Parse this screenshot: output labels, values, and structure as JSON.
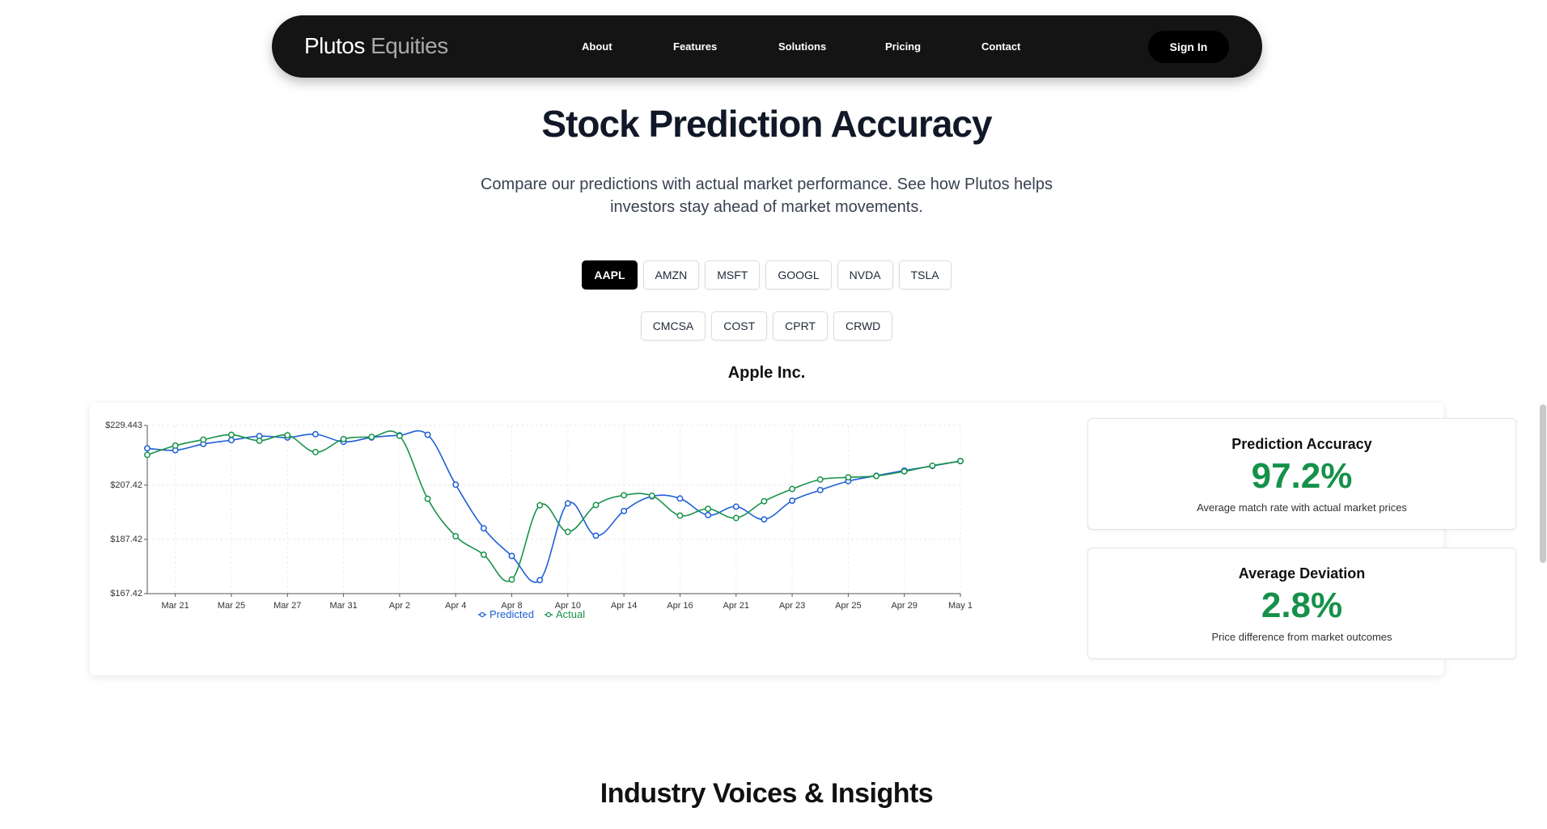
{
  "nav": {
    "brand_primary": "Plutos",
    "brand_secondary": "Equities",
    "links": [
      "About",
      "Features",
      "Solutions",
      "Pricing",
      "Contact"
    ],
    "signin_label": "Sign In"
  },
  "hero": {
    "title": "Stock Prediction Accuracy",
    "subtitle": "Compare our predictions with actual market performance. See how Plutos helps investors stay ahead of market movements."
  },
  "tickers": {
    "row1": [
      "AAPL",
      "AMZN",
      "MSFT",
      "GOOGL",
      "NVDA",
      "TSLA"
    ],
    "row2": [
      "CMCSA",
      "COST",
      "CPRT",
      "CRWD"
    ],
    "active": "AAPL"
  },
  "company_name": "Apple Inc.",
  "cards": [
    {
      "title": "Prediction Accuracy",
      "value": "97.2%",
      "desc": "Average match rate with actual market prices"
    },
    {
      "title": "Average Deviation",
      "value": "2.8%",
      "desc": "Price difference from market outcomes"
    }
  ],
  "section2_title": "Industry Voices & Insights",
  "colors": {
    "predicted": "#1f5fd6",
    "actual": "#17924a",
    "accent_green": "#16914a",
    "nav_bg": "#141414"
  },
  "chart_data": {
    "type": "line",
    "title": "",
    "xlabel": "",
    "ylabel": "",
    "y_ticks": [
      "$229.443",
      "$207.42",
      "$187.42",
      "$167.42"
    ],
    "y_tick_values": [
      229.443,
      207.42,
      187.42,
      167.42
    ],
    "ylim": [
      167.42,
      229.443
    ],
    "x_ticks": [
      "Mar 21",
      "Mar 25",
      "Mar 27",
      "Mar 31",
      "Apr 2",
      "Apr 4",
      "Apr 8",
      "Apr 10",
      "Apr 14",
      "Apr 16",
      "Apr 21",
      "Apr 23",
      "Apr 25",
      "Apr 29",
      "May 1"
    ],
    "x_tick_index": [
      1,
      3,
      5,
      7,
      9,
      11,
      13,
      15,
      17,
      19,
      21,
      23,
      25,
      27,
      29
    ],
    "x_count": 30,
    "grid": true,
    "legend": "bottom",
    "series": [
      {
        "name": "Predicted",
        "values": [
          221.0,
          220.3,
          222.6,
          224.0,
          225.5,
          225.0,
          226.2,
          223.4,
          225.0,
          225.8,
          226.0,
          207.6,
          191.5,
          181.3,
          172.4,
          200.7,
          188.8,
          197.9,
          203.3,
          202.5,
          196.4,
          199.5,
          194.8,
          201.7,
          205.6,
          208.9,
          210.9,
          212.8,
          214.5,
          216.3
        ]
      },
      {
        "name": "Actual",
        "values": [
          218.6,
          222.0,
          224.2,
          226.0,
          223.8,
          225.8,
          219.6,
          224.4,
          225.2,
          225.6,
          202.4,
          188.6,
          181.8,
          172.6,
          200.0,
          190.2,
          200.1,
          203.7,
          203.5,
          196.2,
          198.7,
          195.3,
          201.5,
          206.0,
          209.5,
          210.3,
          210.8,
          212.5,
          214.6,
          216.3
        ]
      }
    ]
  }
}
